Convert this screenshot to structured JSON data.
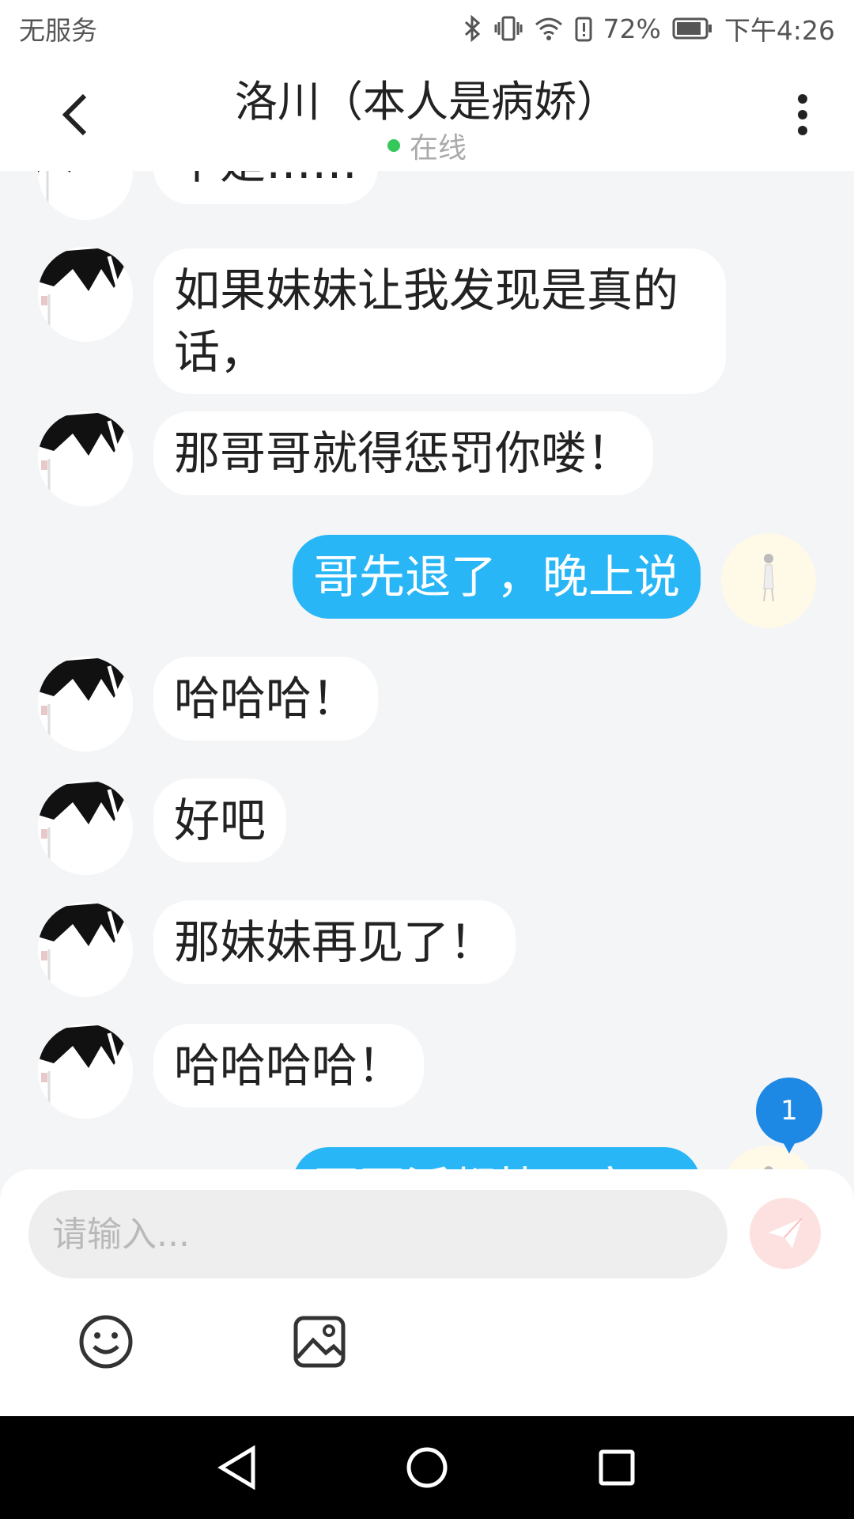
{
  "status_bar": {
    "carrier": "无服务",
    "battery": "72%",
    "time": "下午4:26"
  },
  "header": {
    "title": "洛川（本人是病娇）",
    "presence": "在线"
  },
  "messages": [
    {
      "sender": "other",
      "text": "不是……"
    },
    {
      "sender": "other",
      "text": "如果妹妹让我发现是真的话，"
    },
    {
      "sender": "other",
      "text": "那哥哥就得惩罚你喽！"
    },
    {
      "sender": "me",
      "text": "哥先退了，晚上说"
    },
    {
      "sender": "other",
      "text": "哈哈哈！"
    },
    {
      "sender": "other",
      "text": "好吧"
    },
    {
      "sender": "other",
      "text": "那妹妹再见了！"
    },
    {
      "sender": "other",
      "text": "哈哈哈哈！"
    },
    {
      "sender": "me",
      "text": "哥哥活都快干完了"
    }
  ],
  "unread_badge": "1",
  "composer": {
    "placeholder": "请输入..."
  },
  "icons": {
    "back": "chevron-left-icon",
    "more": "more-vertical-icon",
    "send": "send-icon",
    "emoji": "emoji-icon",
    "image": "image-icon",
    "nav_back": "triangle-back-icon",
    "nav_home": "circle-home-icon",
    "nav_recents": "square-recents-icon"
  },
  "colors": {
    "accent": "#29b6f6",
    "online": "#35c759",
    "badge": "#1e88e5"
  }
}
